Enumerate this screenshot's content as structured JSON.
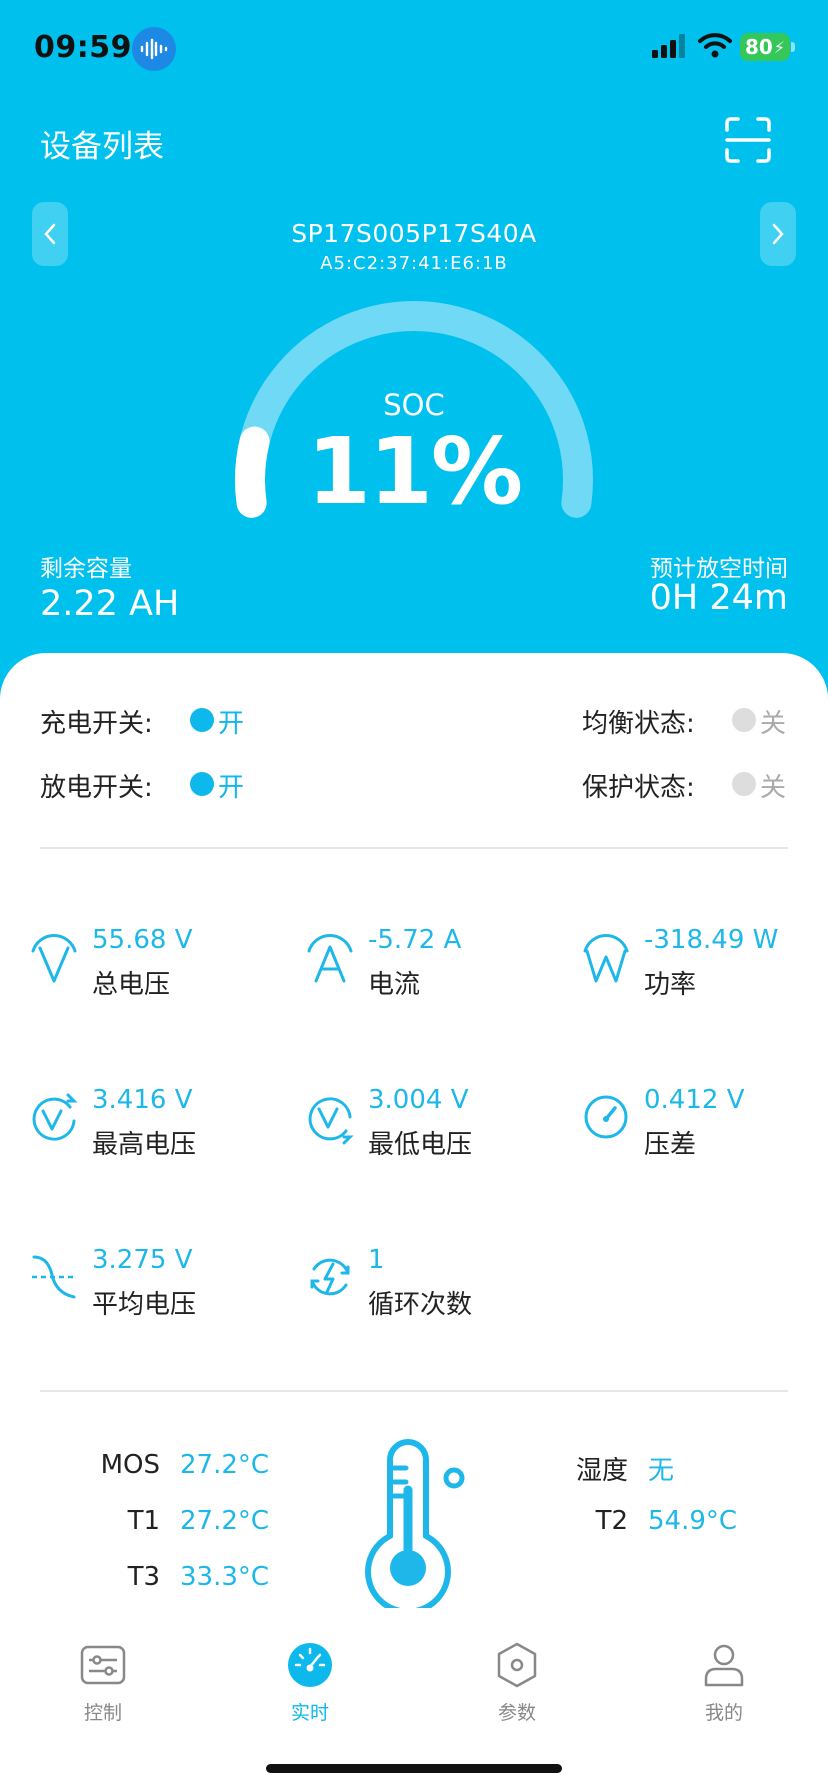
{
  "status_bar": {
    "time": "09:59",
    "battery": "80"
  },
  "header": {
    "title": "设备列表"
  },
  "device": {
    "name": "SP17S005P17S40A",
    "mac": "A5:C2:37:41:E6:1B"
  },
  "soc": {
    "label": "SOC",
    "value_text": "11%",
    "value": 11
  },
  "remaining": {
    "label": "剩余容量",
    "value": "2.22 AH"
  },
  "discharge_time": {
    "label": "预计放空时间",
    "value": "0H 24m"
  },
  "switches": [
    {
      "label": "充电开关:",
      "state": "开",
      "on": true
    },
    {
      "label": "均衡状态:",
      "state": "关",
      "on": false
    },
    {
      "label": "放电开关:",
      "state": "开",
      "on": true
    },
    {
      "label": "保护状态:",
      "state": "关",
      "on": false
    }
  ],
  "metrics": [
    {
      "value": "55.68 V",
      "label": "总电压",
      "icon": "voltage-v-icon"
    },
    {
      "value": "-5.72 A",
      "label": "电流",
      "icon": "current-a-icon"
    },
    {
      "value": "-318.49 W",
      "label": "功率",
      "icon": "power-w-icon"
    },
    {
      "value": "3.416 V",
      "label": "最高电压",
      "icon": "max-voltage-icon"
    },
    {
      "value": "3.004 V",
      "label": "最低电压",
      "icon": "min-voltage-icon"
    },
    {
      "value": "0.412 V",
      "label": "压差",
      "icon": "gauge-icon"
    },
    {
      "value": "3.275 V",
      "label": "平均电压",
      "icon": "average-wave-icon"
    },
    {
      "value": "1",
      "label": "循环次数",
      "icon": "cycle-icon"
    }
  ],
  "temperatures": {
    "mos": {
      "label": "MOS",
      "value": "27.2°C"
    },
    "t1": {
      "label": "T1",
      "value": "27.2°C"
    },
    "t3": {
      "label": "T3",
      "value": "33.3°C"
    },
    "humidity": {
      "label": "湿度",
      "value": "无"
    },
    "t2": {
      "label": "T2",
      "value": "54.9°C"
    }
  },
  "tabs": [
    {
      "label": "控制",
      "icon": "sliders-icon",
      "active": false
    },
    {
      "label": "实时",
      "icon": "dashboard-icon",
      "active": true
    },
    {
      "label": "参数",
      "icon": "hexagon-nut-icon",
      "active": false
    },
    {
      "label": "我的",
      "icon": "user-icon",
      "active": false
    }
  ],
  "colors": {
    "primary": "#00C0EE",
    "accent": "#1EB7E9",
    "on": "#0DB8EC",
    "off": "#DDDDDD",
    "battery": "#34C759"
  }
}
